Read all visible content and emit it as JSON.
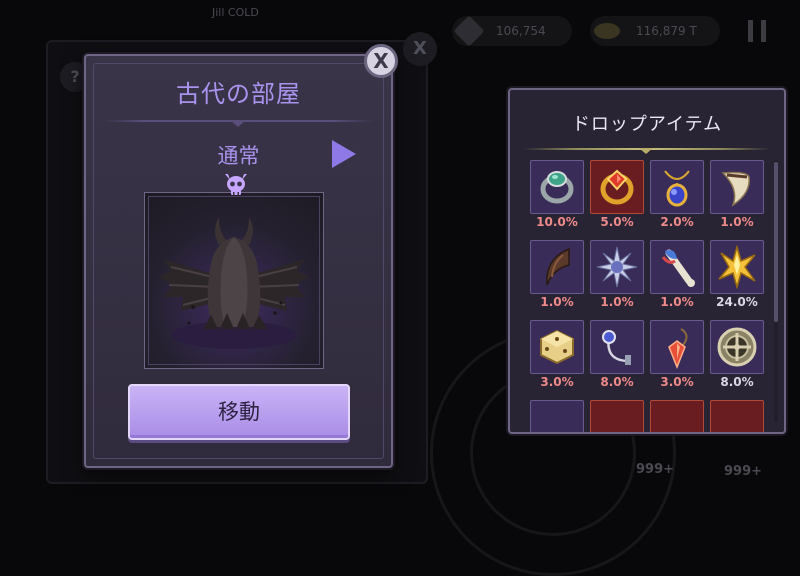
{
  "background": {
    "small_label": "Jill COLD",
    "gem_count": "106,754",
    "gold_count": "116,879 T",
    "badge_left": "999+",
    "badge_right": "999+"
  },
  "room_dialog": {
    "title": "古代の部屋",
    "close_label": "X",
    "difficulty": "通常",
    "move_button": "移動"
  },
  "drop_panel": {
    "title": "ドロップアイテム",
    "items": [
      {
        "icon": "jade-ring-icon",
        "rate": "10.0%",
        "rare": false
      },
      {
        "icon": "ruby-ring-icon",
        "rate": "5.0%",
        "rare": true
      },
      {
        "icon": "sapphire-amulet-icon",
        "rate": "2.0%",
        "rare": false
      },
      {
        "icon": "ivory-horn-icon",
        "rate": "1.0%",
        "rare": false
      },
      {
        "icon": "dark-claw-icon",
        "rate": "1.0%",
        "rare": false
      },
      {
        "icon": "spiked-orb-icon",
        "rate": "1.0%",
        "rare": false
      },
      {
        "icon": "feathered-bone-icon",
        "rate": "1.0%",
        "rare": false
      },
      {
        "icon": "gold-star-shard-icon",
        "rate": "24.0%",
        "rare": false
      },
      {
        "icon": "gold-dice-icon",
        "rate": "3.0%",
        "rare": false
      },
      {
        "icon": "silver-pendant-icon",
        "rate": "8.0%",
        "rare": false
      },
      {
        "icon": "red-crystal-necklace-icon",
        "rate": "3.0%",
        "rare": false
      },
      {
        "icon": "round-shield-icon",
        "rate": "8.0%",
        "rare": false
      }
    ]
  },
  "colors": {
    "accent_purple": "#a993ee",
    "rate_red": "#ef8a8a",
    "panel_bg": "#292433"
  }
}
